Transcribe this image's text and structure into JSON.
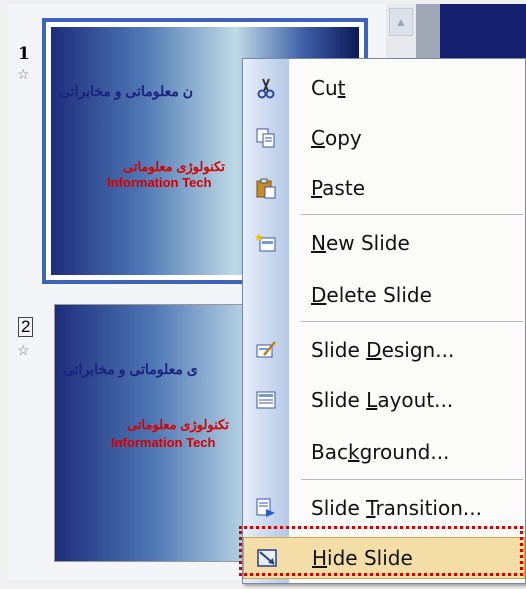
{
  "slides": [
    {
      "number": "1",
      "line1": "ن معلوماتی و مخابراتی",
      "line2": "تکنولوژی معلوماتی",
      "line3": "Information Tech"
    },
    {
      "number": "2",
      "line1": "ی معلوماتی و مخابراتی",
      "line2": "تکنولوژی معلوماتی",
      "line3": "Information Tech"
    }
  ],
  "star": "☆",
  "menu": {
    "items": [
      {
        "pre": "Cu",
        "u": "t",
        "post": "",
        "icon": "scissors-icon"
      },
      {
        "pre": "",
        "u": "C",
        "post": "opy",
        "icon": "copy-icon"
      },
      {
        "pre": "",
        "u": "P",
        "post": "aste",
        "icon": "paste-icon"
      },
      {
        "pre": "",
        "u": "N",
        "post": "ew Slide",
        "icon": "new-slide-icon"
      },
      {
        "pre": "",
        "u": "D",
        "post": "elete Slide",
        "icon": ""
      },
      {
        "pre": "Slide ",
        "u": "D",
        "post": "esign...",
        "icon": "slide-design-icon"
      },
      {
        "pre": "Slide ",
        "u": "L",
        "post": "ayout...",
        "icon": "slide-layout-icon"
      },
      {
        "pre": "Bac",
        "u": "k",
        "post": "ground...",
        "icon": ""
      },
      {
        "pre": "Slide ",
        "u": "T",
        "post": "ransition...",
        "icon": "slide-transition-icon"
      },
      {
        "pre": "",
        "u": "H",
        "post": "ide Slide",
        "icon": "hide-slide-icon"
      }
    ]
  },
  "colors": {
    "selection_border": "#3d64b8",
    "highlight_fill": "#f4dea8",
    "annotation_outline": "#d40000"
  }
}
